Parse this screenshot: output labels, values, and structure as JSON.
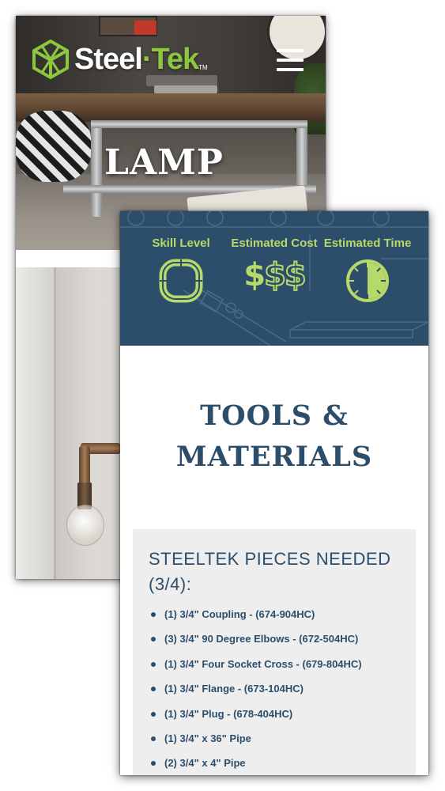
{
  "brand": {
    "name_part1": "Steel",
    "name_part2": "Tek",
    "trademark": "TM",
    "accent_color": "#8dc63f",
    "primary_color": "#2d4e6b"
  },
  "header": {
    "menu_icon": "hamburger-menu-icon"
  },
  "hero": {
    "title": "LAMP"
  },
  "stats": [
    {
      "label": "Skill Level",
      "icon": "pipe-loop-icon"
    },
    {
      "label": "Estimated Cost",
      "symbols": [
        "$",
        "$",
        "$"
      ],
      "filled_count": 1
    },
    {
      "label": "Estimated Time",
      "icon": "clock-icon",
      "filled_fraction": 0.5
    }
  ],
  "tools": {
    "title_line1": "TOOLS &",
    "title_line2": "MATERIALS"
  },
  "pieces": {
    "heading": "STEELTEK PIECES NEEDED (3/4):",
    "items": [
      "(1) 3/4\" Coupling - (674-904HC)",
      "(3) 3/4\" 90 Degree Elbows - (672-504HC)",
      "(1) 3/4\" Four Socket Cross - (679-804HC)",
      "(1) 3/4\" Flange - (673-104HC)",
      "(1) 3/4\" Plug - (678-404HC)",
      "(1) 3/4\" x 36\" Pipe",
      "(2) 3/4\" x 4\" Pipe"
    ]
  }
}
